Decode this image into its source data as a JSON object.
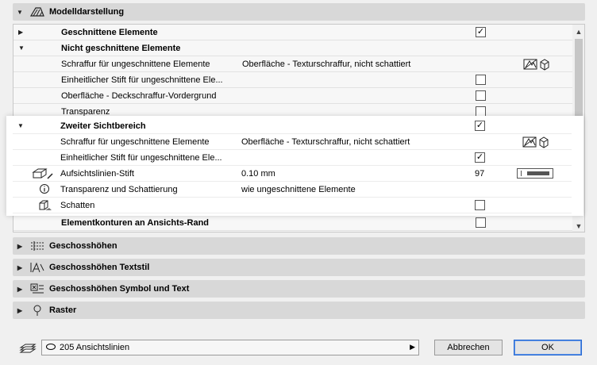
{
  "sections": {
    "modell": "Modelldarstellung",
    "geschoss": "Geschosshöhen",
    "geschoss_textstil": "Geschosshöhen Textstil",
    "geschoss_symbol": "Geschosshöhen Symbol und Text",
    "raster": "Raster"
  },
  "tree": {
    "geschnittene": "Geschnittene Elemente",
    "nicht_geschnittene": "Nicht geschnittene Elemente",
    "schraffur1_label": "Schraffur für ungeschnittene Elemente",
    "schraffur1_value": "Oberfläche - Texturschraffur, nicht schattiert",
    "stift1_label": "Einheitlicher Stift für ungeschnittene Ele...",
    "oberflaeche_label": "Oberfläche - Deckschraffur-Vordergrund",
    "transparenz_label": "Transparenz",
    "zweiter": "Zweiter Sichtbereich",
    "schraffur2_label": "Schraffur für ungeschnittene Elemente",
    "schraffur2_value": "Oberfläche - Texturschraffur, nicht schattiert",
    "stift2_label": "Einheitlicher Stift für ungeschnittene Ele...",
    "aufsicht_label": "Aufsichtslinien-Stift",
    "aufsicht_value": "0.10 mm",
    "aufsicht_pen": "97",
    "transp_schatt_label": "Transparenz und Schattierung",
    "transp_schatt_value": "wie ungeschnittene Elemente",
    "schatten_label": "Schatten",
    "konturen_label": "Elementkonturen an Ansichts-Rand"
  },
  "checks": {
    "geschnittene": "✓",
    "stift1": "",
    "oberflaeche": "",
    "transparenz": "",
    "zweiter": "✓",
    "stift2": "✓",
    "schatten": "",
    "konturen": ""
  },
  "footer": {
    "dropdown": "205 Ansichtslinien",
    "cancel": "Abbrechen",
    "ok": "OK"
  }
}
